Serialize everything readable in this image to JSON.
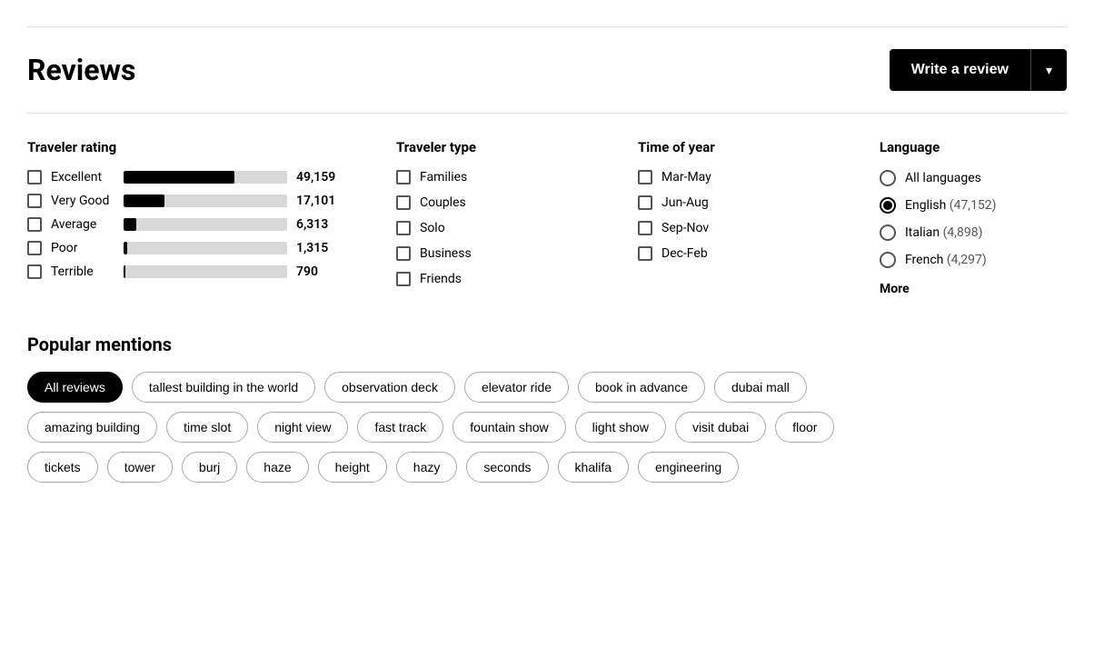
{
  "header": {
    "title": "Reviews",
    "write_review_label": "Write a review",
    "dropdown_arrow": "▾"
  },
  "traveler_rating": {
    "heading": "Traveler rating",
    "items": [
      {
        "label": "Excellent",
        "count": "49,159",
        "bar_pct": 68
      },
      {
        "label": "Very Good",
        "count": "17,101",
        "bar_pct": 25
      },
      {
        "label": "Average",
        "count": "6,313",
        "bar_pct": 8
      },
      {
        "label": "Poor",
        "count": "1,315",
        "bar_pct": 2
      },
      {
        "label": "Terrible",
        "count": "790",
        "bar_pct": 1
      }
    ]
  },
  "traveler_type": {
    "heading": "Traveler type",
    "items": [
      {
        "label": "Families"
      },
      {
        "label": "Couples"
      },
      {
        "label": "Solo"
      },
      {
        "label": "Business"
      },
      {
        "label": "Friends"
      }
    ]
  },
  "time_of_year": {
    "heading": "Time of year",
    "items": [
      {
        "label": "Mar-May"
      },
      {
        "label": "Jun-Aug"
      },
      {
        "label": "Sep-Nov"
      },
      {
        "label": "Dec-Feb"
      }
    ]
  },
  "language": {
    "heading": "Language",
    "items": [
      {
        "label": "All languages",
        "count": "",
        "selected": false
      },
      {
        "label": "English",
        "count": "(47,152)",
        "selected": true
      },
      {
        "label": "Italian",
        "count": "(4,898)",
        "selected": false
      },
      {
        "label": "French",
        "count": "(4,297)",
        "selected": false
      }
    ],
    "more_label": "More"
  },
  "popular_mentions": {
    "heading": "Popular mentions",
    "rows": [
      [
        {
          "label": "All reviews",
          "active": true
        },
        {
          "label": "tallest building in the world",
          "active": false
        },
        {
          "label": "observation deck",
          "active": false
        },
        {
          "label": "elevator ride",
          "active": false
        },
        {
          "label": "book in advance",
          "active": false
        },
        {
          "label": "dubai mall",
          "active": false
        }
      ],
      [
        {
          "label": "amazing building",
          "active": false
        },
        {
          "label": "time slot",
          "active": false
        },
        {
          "label": "night view",
          "active": false
        },
        {
          "label": "fast track",
          "active": false
        },
        {
          "label": "fountain show",
          "active": false
        },
        {
          "label": "light show",
          "active": false
        },
        {
          "label": "visit dubai",
          "active": false
        },
        {
          "label": "floor",
          "active": false
        }
      ],
      [
        {
          "label": "tickets",
          "active": false
        },
        {
          "label": "tower",
          "active": false
        },
        {
          "label": "burj",
          "active": false
        },
        {
          "label": "haze",
          "active": false
        },
        {
          "label": "height",
          "active": false
        },
        {
          "label": "hazy",
          "active": false
        },
        {
          "label": "seconds",
          "active": false
        },
        {
          "label": "khalifa",
          "active": false
        },
        {
          "label": "engineering",
          "active": false
        }
      ]
    ]
  }
}
